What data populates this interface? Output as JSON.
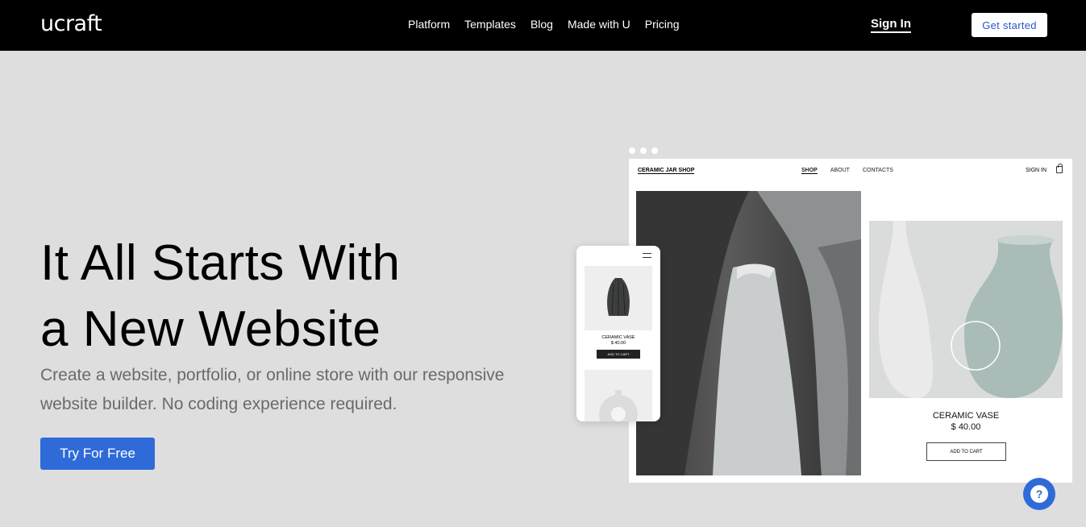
{
  "header": {
    "logo": "ucraft",
    "nav": [
      "Platform",
      "Templates",
      "Blog",
      "Made with U",
      "Pricing"
    ],
    "sign_in": "Sign In",
    "get_started": "Get started"
  },
  "hero": {
    "title_line1": "It All Starts With",
    "title_line2": "a New Website",
    "subtitle": "Create a website, portfolio, or online store with our responsive website builder. No coding experience required.",
    "cta": "Try For Free"
  },
  "mockup": {
    "shop_name": "CERAMIC JAR SHOP",
    "nav": [
      "SHOP",
      "ABOUT",
      "CONTACTS"
    ],
    "sign_in": "SIGN IN",
    "product_title": "CERAMIC VASE",
    "product_price": "$ 40.00",
    "add_to_cart": "ADD TO CART",
    "phone_product_title": "CERAMIC VASE",
    "phone_product_price": "$ 40.00",
    "phone_add_to_cart": "ADD TO CART"
  },
  "help": {
    "icon": "?"
  },
  "colors": {
    "header_bg": "#000000",
    "page_bg": "#dedede",
    "accent": "#2f6bd8"
  }
}
